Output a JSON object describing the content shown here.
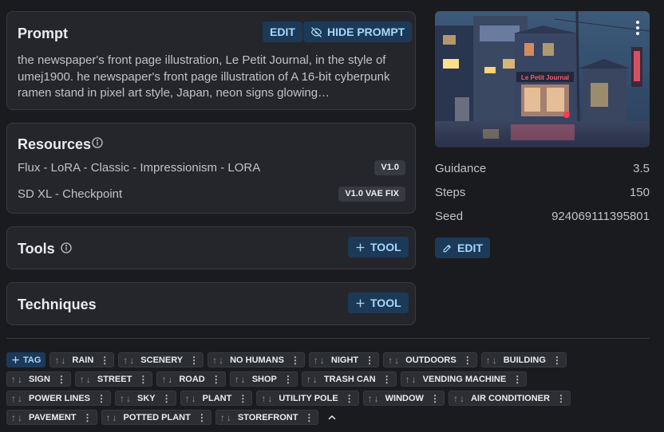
{
  "prompt": {
    "title": "Prompt",
    "edit_label": "EDIT",
    "hide_label": "HIDE PROMPT",
    "text": "the newspaper's front page illustration, Le Petit Journal, in the style of umej1900. he newspaper's front page illustration of A 16-bit cyberpunk ramen stand in pixel art style, Japan, neon signs glowing…"
  },
  "resources": {
    "title": "Resources",
    "items": [
      {
        "name": "Flux - LoRA - Classic - Impressionism - LORA",
        "version": "V1.0"
      },
      {
        "name": "SD XL - Checkpoint",
        "version": "V1.0 VAE FIX"
      }
    ]
  },
  "tools": {
    "title": "Tools",
    "add_label": "TOOL"
  },
  "techniques": {
    "title": "Techniques",
    "add_label": "TOOL"
  },
  "image": {
    "sign_text": "Le Petit Journal"
  },
  "meta": {
    "guidance_label": "Guidance",
    "guidance": "3.5",
    "steps_label": "Steps",
    "steps": "150",
    "seed_label": "Seed",
    "seed": "924069111395801",
    "edit_label": "EDIT"
  },
  "tags": {
    "add_label": "TAG",
    "items": [
      "RAIN",
      "SCENERY",
      "NO HUMANS",
      "NIGHT",
      "OUTDOORS",
      "BUILDING",
      "SIGN",
      "STREET",
      "ROAD",
      "SHOP",
      "TRASH CAN",
      "VENDING MACHINE",
      "POWER LINES",
      "SKY",
      "PLANT",
      "UTILITY POLE",
      "WINDOW",
      "AIR CONDITIONER",
      "PAVEMENT",
      "POTTED PLANT",
      "STOREFRONT"
    ]
  },
  "colors": {
    "accent": "#a5d8ff",
    "button_bg": "#1c3a57",
    "card_bg": "#25262b",
    "page_bg": "#1a1b1e"
  }
}
